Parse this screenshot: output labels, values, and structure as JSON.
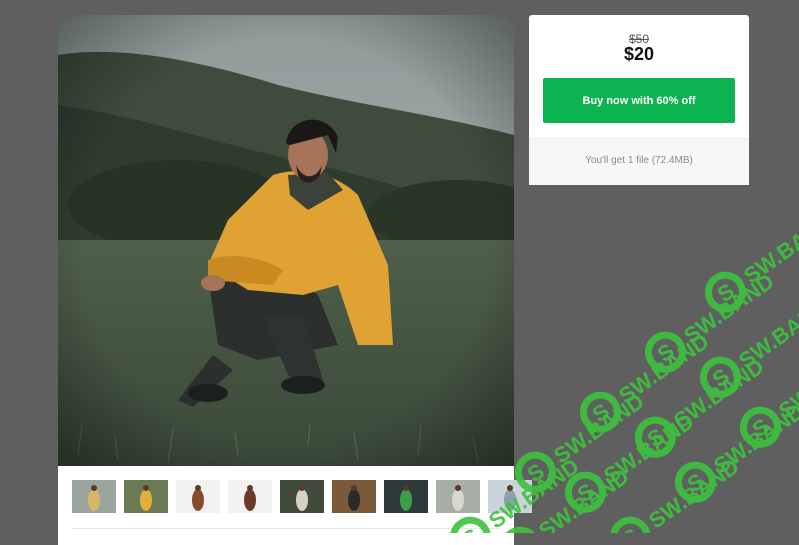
{
  "product": {
    "main_image_alt": "Man in yellow jacket sitting on grassy hillside",
    "thumbnails": [
      {
        "name": "thumb-1",
        "bg": "#9aa39c",
        "fig": "#d8b56a"
      },
      {
        "name": "thumb-2",
        "bg": "#6b7a52",
        "fig": "#e0b03a"
      },
      {
        "name": "thumb-3",
        "bg": "#f2f2f2",
        "fig": "#8a4a2a"
      },
      {
        "name": "thumb-4",
        "bg": "#f2f2f2",
        "fig": "#6a3a2a"
      },
      {
        "name": "thumb-5",
        "bg": "#3f4a3a",
        "fig": "#d9d2c4"
      },
      {
        "name": "thumb-6",
        "bg": "#7a5a3a",
        "fig": "#2a2a2a"
      },
      {
        "name": "thumb-7",
        "bg": "#2f3a3a",
        "fig": "#3aa04a"
      },
      {
        "name": "thumb-8",
        "bg": "#a8aea5",
        "fig": "#d8d8cc"
      },
      {
        "name": "thumb-9",
        "bg": "#c9d4d8",
        "fig": "#8aa0aa"
      }
    ]
  },
  "pricing": {
    "old_price": "$50",
    "new_price": "$20",
    "buy_label": "Buy now with 60% off",
    "file_info": "You'll get 1 file (72.4MB)"
  },
  "watermark": {
    "text": "SW.BAND",
    "color": "#3cc33c"
  },
  "colors": {
    "accent": "#0cb350",
    "background": "#5f5f5f"
  }
}
